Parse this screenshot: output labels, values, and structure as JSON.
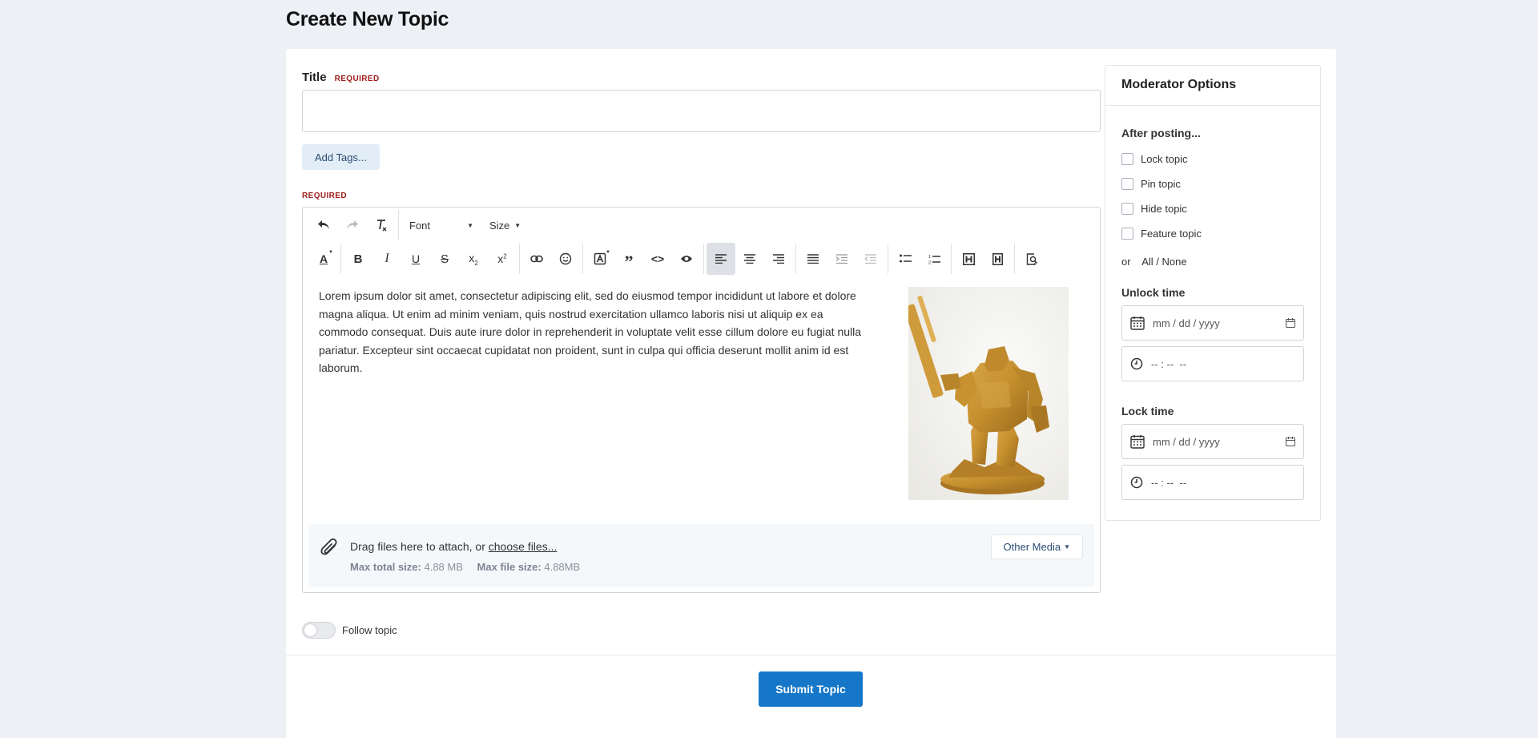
{
  "page": {
    "title": "Create New Topic"
  },
  "form": {
    "title_label": "Title",
    "required": "REQUIRED",
    "title_value": "",
    "add_tags": "Add Tags...",
    "body_required": "REQUIRED"
  },
  "toolbar": {
    "font_label": "Font",
    "size_label": "Size"
  },
  "editor": {
    "body_text": "Lorem ipsum dolor sit amet, consectetur adipiscing elit, sed do eiusmod tempor incididunt ut labore et dolore magna aliqua. Ut enim ad minim veniam, quis nostrud exercitation ullamco laboris nisi ut aliquip ex ea commodo consequat. Duis aute irure dolor in reprehenderit in voluptate velit esse cillum dolore eu fugiat nulla pariatur. Excepteur sint occaecat cupidatat non proident, sunt in culpa qui officia deserunt mollit anim id est laborum."
  },
  "attach": {
    "text": "Drag files here to attach, or ",
    "link": "choose files...",
    "max_total_label": "Max total size:",
    "max_total_value": "4.88 MB",
    "max_file_label": "Max file size:",
    "max_file_value": "4.88MB",
    "other_media": "Other Media"
  },
  "follow": {
    "label": "Follow topic",
    "on": false
  },
  "submit": {
    "label": "Submit Topic"
  },
  "moderator": {
    "title": "Moderator Options",
    "after_posting": "After posting...",
    "options": [
      "Lock topic",
      "Pin topic",
      "Hide topic",
      "Feature topic"
    ],
    "or": "or",
    "all_none": "All / None",
    "unlock_time": "Unlock time",
    "lock_time": "Lock time",
    "date_placeholder": "mm / dd / yyyy",
    "time_placeholder": "-- : --  --"
  },
  "colors": {
    "primary": "#1677c9",
    "required": "#a01e1e",
    "background": "#edf0f4"
  }
}
